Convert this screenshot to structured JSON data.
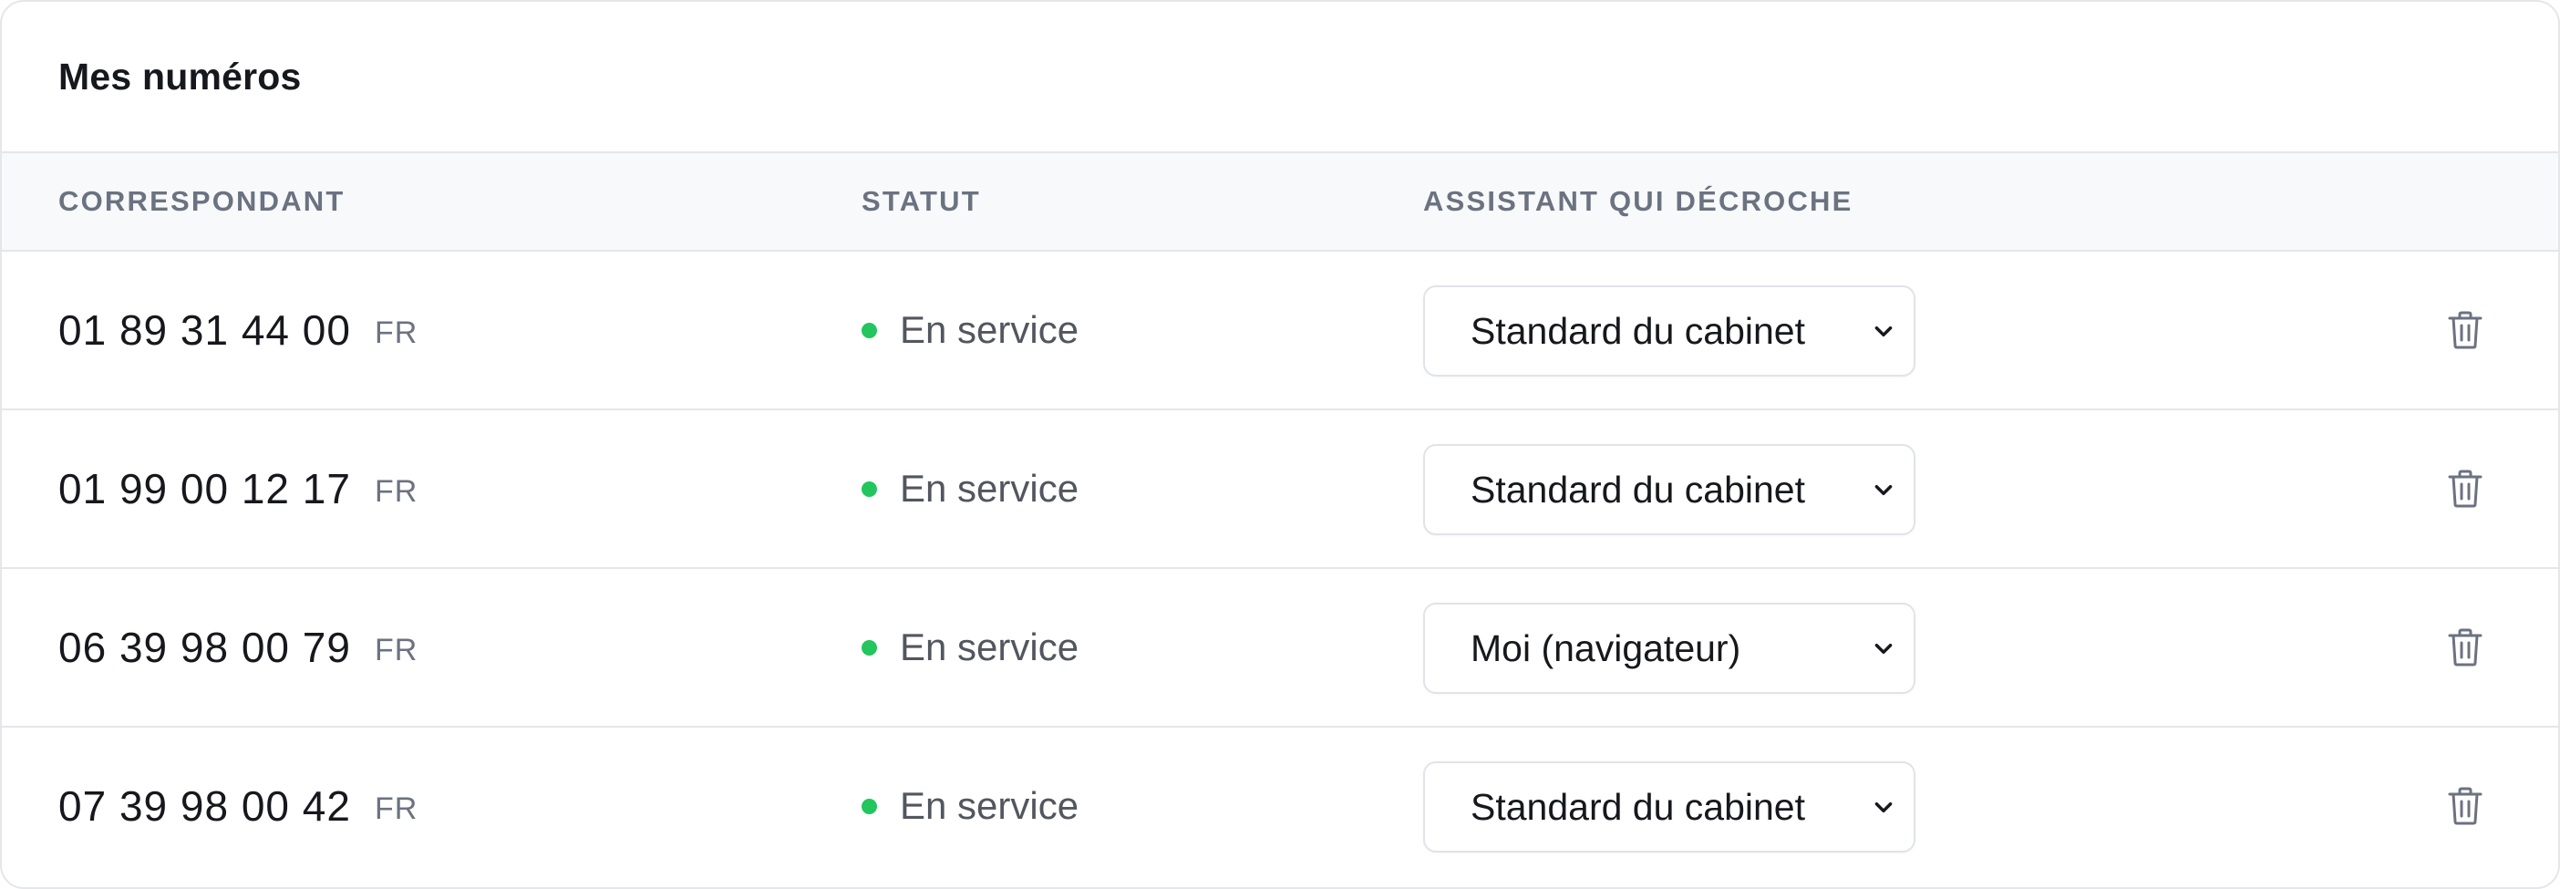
{
  "card": {
    "title": "Mes numéros"
  },
  "table": {
    "columns": {
      "correspondant": "CORRESPONDANT",
      "statut": "STATUT",
      "assistant": "ASSISTANT QUI DÉCROCHE"
    },
    "rows": [
      {
        "number": "01 89 31 44 00",
        "country": "FR",
        "status": "En service",
        "assistant": "Standard du cabinet"
      },
      {
        "number": "01 99 00 12 17",
        "country": "FR",
        "status": "En service",
        "assistant": "Standard du cabinet"
      },
      {
        "number": "06 39 98 00 79",
        "country": "FR",
        "status": "En service",
        "assistant": "Moi (navigateur)"
      },
      {
        "number": "07 39 98 00 42",
        "country": "FR",
        "status": "En service",
        "assistant": "Standard du cabinet"
      }
    ]
  },
  "icons": {
    "status": "status-dot-icon",
    "select": "chevron-down-icon",
    "delete": "trash-icon"
  },
  "colors": {
    "status_active": "#22c55e",
    "header_bg": "#f8f9fb",
    "border": "#e4e6ea",
    "muted_text": "#6b7280"
  }
}
